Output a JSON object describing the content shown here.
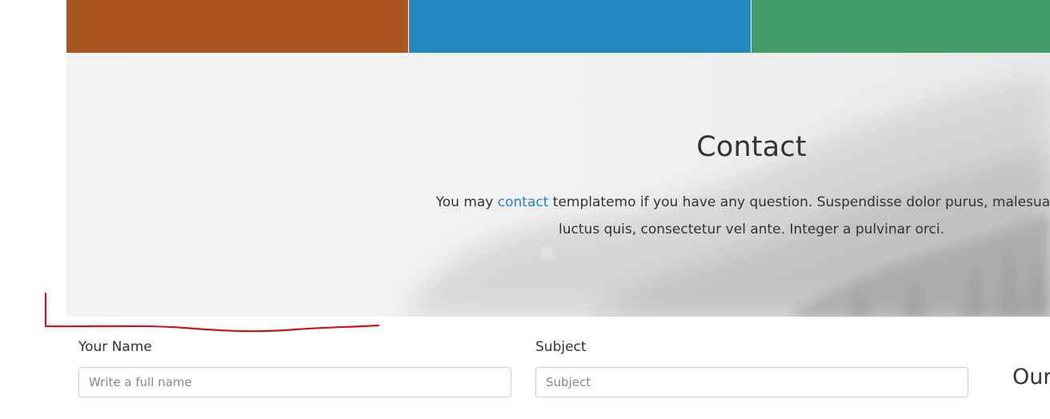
{
  "colors": {
    "tile_orange": "#ab5521",
    "tile_blue": "#2287bd",
    "tile_green": "#459a69",
    "link": "#2184c3",
    "annotation_red": "#d0131a"
  },
  "banner": {
    "title": "Contact",
    "text_before_link": "You may ",
    "link_text": "contact",
    "text_after_link_line1": " templatemo if you have any question. Suspendisse dolor purus, malesuada",
    "text_line2": "luctus quis, consectetur vel ante. Integer a pulvinar orci."
  },
  "form": {
    "name_label": "Your Name",
    "name_placeholder": "Write a full name",
    "subject_label": "Subject",
    "subject_placeholder": "Subject"
  },
  "sidebar": {
    "heading": "Our"
  }
}
